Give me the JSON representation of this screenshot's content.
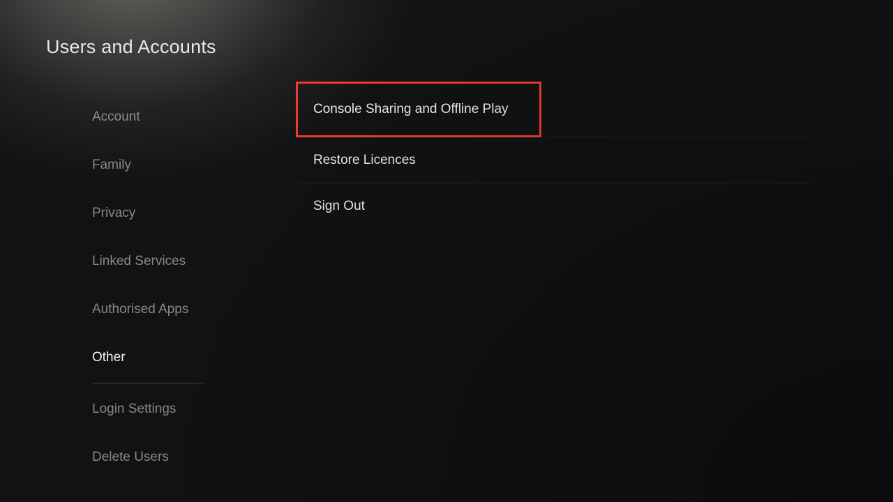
{
  "page": {
    "title": "Users and Accounts"
  },
  "sidebar": {
    "items": [
      {
        "label": "Account",
        "active": false
      },
      {
        "label": "Family",
        "active": false
      },
      {
        "label": "Privacy",
        "active": false
      },
      {
        "label": "Linked Services",
        "active": false
      },
      {
        "label": "Authorised Apps",
        "active": false
      },
      {
        "label": "Other",
        "active": true
      },
      {
        "label": "Login Settings",
        "active": false
      },
      {
        "label": "Delete Users",
        "active": false
      }
    ]
  },
  "content": {
    "items": [
      {
        "label": "Console Sharing and Offline Play",
        "highlighted": true
      },
      {
        "label": "Restore Licences",
        "highlighted": false
      },
      {
        "label": "Sign Out",
        "highlighted": false
      }
    ]
  },
  "highlight": {
    "color": "#f03a2d"
  }
}
